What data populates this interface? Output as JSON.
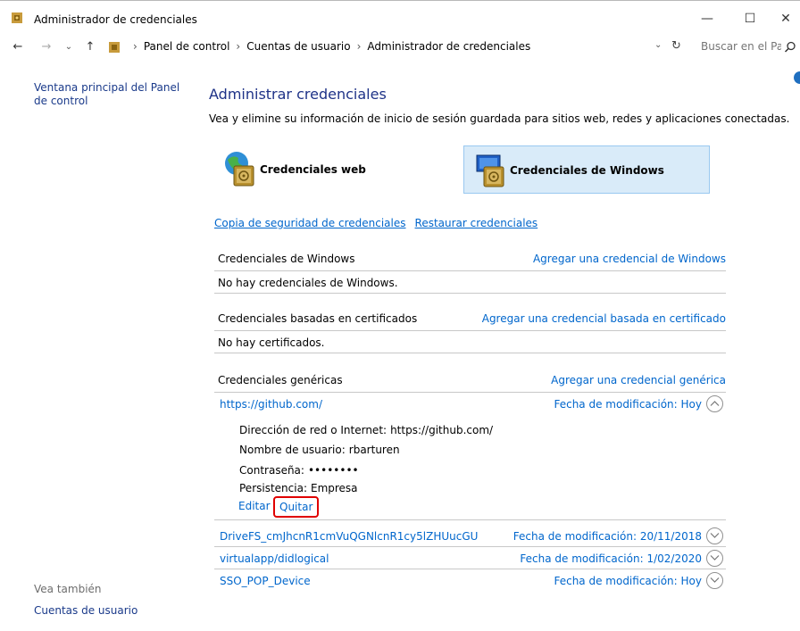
{
  "window": {
    "title": "Administrador de credenciales",
    "minimize_glyph": "—",
    "maximize_glyph": "☐",
    "close_glyph": "✕"
  },
  "address": {
    "crumbs": [
      "Panel de control",
      "Cuentas de usuario",
      "Administrador de credenciales"
    ],
    "search_placeholder": "Buscar en el Pa..."
  },
  "sidebar": {
    "main_link": "Ventana principal del Panel de control",
    "see_also": "Vea también",
    "user_accounts": "Cuentas de usuario"
  },
  "main": {
    "title": "Administrar credenciales",
    "description": "Vea y elimine su información de inicio de sesión guardada para sitios web, redes y aplicaciones conectadas.",
    "web_credentials": "Credenciales web",
    "windows_credentials": "Credenciales de Windows",
    "backup_link": "Copia de seguridad de credenciales",
    "restore_link": "Restaurar credenciales"
  },
  "sections": {
    "windows": {
      "title": "Credenciales de Windows",
      "action": "Agregar una credencial de Windows",
      "empty": "No hay credenciales de Windows."
    },
    "certificates": {
      "title": "Credenciales basadas en certificados",
      "action": "Agregar una credencial basada en certificado",
      "empty": "No hay certificados."
    },
    "generic": {
      "title": "Credenciales genéricas",
      "action": "Agregar una credencial genérica"
    }
  },
  "generic_credentials": [
    {
      "name": "https://github.com/",
      "modified_label": "Fecha de modificación:",
      "modified": "Hoy",
      "expanded": true
    },
    {
      "name": "DriveFS_cmJhcnR1cmVuQGNlcnR1cy5lZHUucGU",
      "modified_label": "Fecha de modificación:",
      "modified": "20/11/2018",
      "expanded": false
    },
    {
      "name": "virtualapp/didlogical",
      "modified_label": "Fecha de modificación:",
      "modified": "1/02/2020",
      "expanded": false
    },
    {
      "name": "SSO_POP_Device",
      "modified_label": "Fecha de modificación:",
      "modified": "Hoy",
      "expanded": false
    }
  ],
  "details": {
    "address_label": "Dirección de red o Internet:",
    "address_value": "https://github.com/",
    "user_label": "Nombre de usuario:",
    "user_value": "rbarturen",
    "password_label": "Contraseña:",
    "password_value": "••••••••",
    "persistence_label": "Persistencia:",
    "persistence_value": "Empresa",
    "edit": "Editar",
    "remove": "Quitar"
  },
  "colors": {
    "link": "#0066cc",
    "heading": "#1e3287",
    "selected_bg": "#d9ebf9",
    "highlight": "#e00000"
  }
}
